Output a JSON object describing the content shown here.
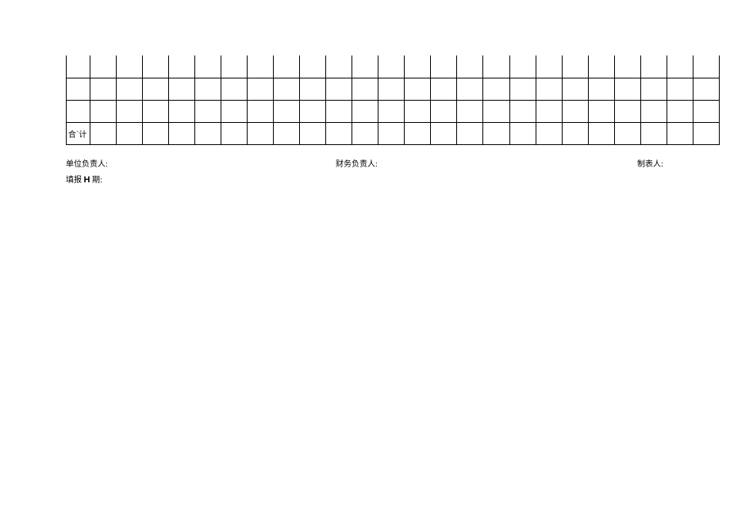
{
  "table": {
    "rows": [
      {
        "cells": [
          "",
          "",
          "",
          "",
          "",
          "",
          "",
          "",
          "",
          "",
          "",
          "",
          "",
          "",
          "",
          "",
          "",
          "",
          "",
          "",
          "",
          "",
          "",
          "",
          ""
        ]
      },
      {
        "cells": [
          "",
          "",
          "",
          "",
          "",
          "",
          "",
          "",
          "",
          "",
          "",
          "",
          "",
          "",
          "",
          "",
          "",
          "",
          "",
          "",
          "",
          "",
          "",
          "",
          ""
        ]
      },
      {
        "cells": [
          "",
          "",
          "",
          "",
          "",
          "",
          "",
          "",
          "",
          "",
          "",
          "",
          "",
          "",
          "",
          "",
          "",
          "",
          "",
          "",
          "",
          "",
          "",
          "",
          ""
        ]
      },
      {
        "cells": [
          "合`计",
          "",
          "",
          "",
          "",
          "",
          "",
          "",
          "",
          "",
          "",
          "",
          "",
          "",
          "",
          "",
          "",
          "",
          "",
          "",
          "",
          "",
          "",
          "",
          ""
        ]
      }
    ]
  },
  "footer": {
    "unit_head_label": "单位负责人:",
    "finance_head_label": "财务负责人:",
    "preparer_label": "制表人:",
    "fill_date_prefix": "填报",
    "fill_date_h": "H",
    "fill_date_suffix": "期:"
  }
}
